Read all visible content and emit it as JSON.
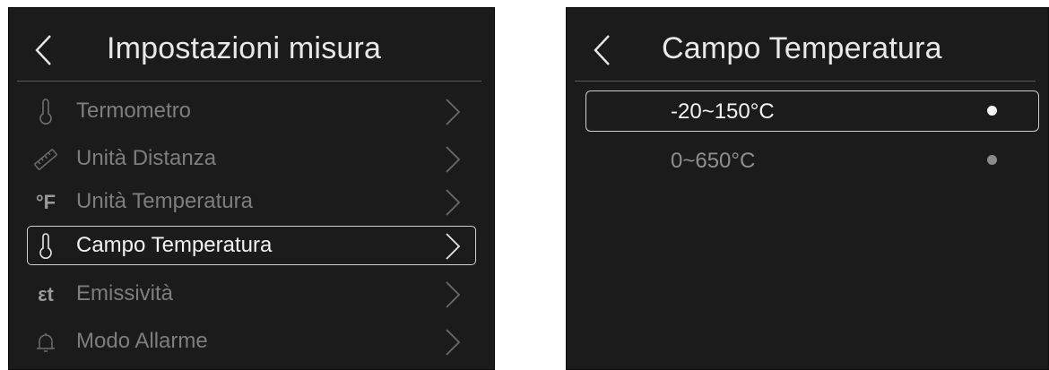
{
  "left_screen": {
    "title": "Impostazioni misura",
    "items": [
      {
        "label": "Termometro",
        "icon": "thermometer-icon"
      },
      {
        "label": "Unità Distanza",
        "icon": "ruler-icon"
      },
      {
        "label": "Unità Temperatura",
        "icon": "fahrenheit-icon",
        "glyph": "°F"
      },
      {
        "label": "Campo Temperatura",
        "icon": "thermometer-icon",
        "selected": true
      },
      {
        "label": "Emissività",
        "icon": "emissivity-icon",
        "glyph": "εt"
      },
      {
        "label": "Modo Allarme",
        "icon": "bell-icon"
      }
    ]
  },
  "right_screen": {
    "title": "Campo Temperatura",
    "options": [
      {
        "label": "-20~150°C",
        "selected": true
      },
      {
        "label": "0~650°C",
        "selected": false
      }
    ]
  },
  "colors": {
    "screen_bg": "#1b1b1b",
    "active_text": "#f2f2f2",
    "inactive_text": "#7e7e7e",
    "inactive_option": "#8f8f8f"
  }
}
